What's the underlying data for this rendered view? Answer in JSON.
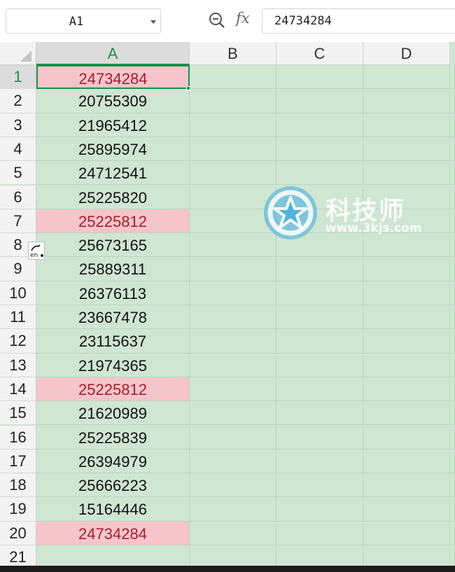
{
  "formula_bar": {
    "name_box": "A1",
    "fx_label": "fx",
    "formula_value": "24734284"
  },
  "columns": [
    "A",
    "B",
    "C",
    "D"
  ],
  "active_column": "A",
  "rows": [
    {
      "row": "1",
      "value": "24734284",
      "duplicate": true
    },
    {
      "row": "2",
      "value": "20755309",
      "duplicate": false
    },
    {
      "row": "3",
      "value": "21965412",
      "duplicate": false
    },
    {
      "row": "4",
      "value": "25895974",
      "duplicate": false
    },
    {
      "row": "5",
      "value": "24712541",
      "duplicate": false
    },
    {
      "row": "6",
      "value": "25225820",
      "duplicate": false
    },
    {
      "row": "7",
      "value": "25225812",
      "duplicate": true
    },
    {
      "row": "8",
      "value": "25673165",
      "duplicate": false
    },
    {
      "row": "9",
      "value": "25889311",
      "duplicate": false
    },
    {
      "row": "10",
      "value": "26376113",
      "duplicate": false
    },
    {
      "row": "11",
      "value": "23667478",
      "duplicate": false
    },
    {
      "row": "12",
      "value": "23115637",
      "duplicate": false
    },
    {
      "row": "13",
      "value": "21974365",
      "duplicate": false
    },
    {
      "row": "14",
      "value": "25225812",
      "duplicate": true
    },
    {
      "row": "15",
      "value": "21620989",
      "duplicate": false
    },
    {
      "row": "16",
      "value": "25225839",
      "duplicate": false
    },
    {
      "row": "17",
      "value": "26394979",
      "duplicate": false
    },
    {
      "row": "18",
      "value": "25666223",
      "duplicate": false
    },
    {
      "row": "19",
      "value": "15164446",
      "duplicate": false
    },
    {
      "row": "20",
      "value": "24734284",
      "duplicate": true
    },
    {
      "row": "21",
      "value": "",
      "duplicate": false
    }
  ],
  "selected_cell": "A1",
  "colors": {
    "grid_background": "#cfe6d2",
    "duplicate_fill": "#f6c4cb",
    "duplicate_text": "#a31f2b",
    "selection": "#1f8f4d"
  },
  "ime_indicator": {
    "label": "en",
    "icon": "ime-icon"
  },
  "watermark": {
    "title": "科技师",
    "url": "www.3kjs.com",
    "icon": "star-logo-icon"
  }
}
